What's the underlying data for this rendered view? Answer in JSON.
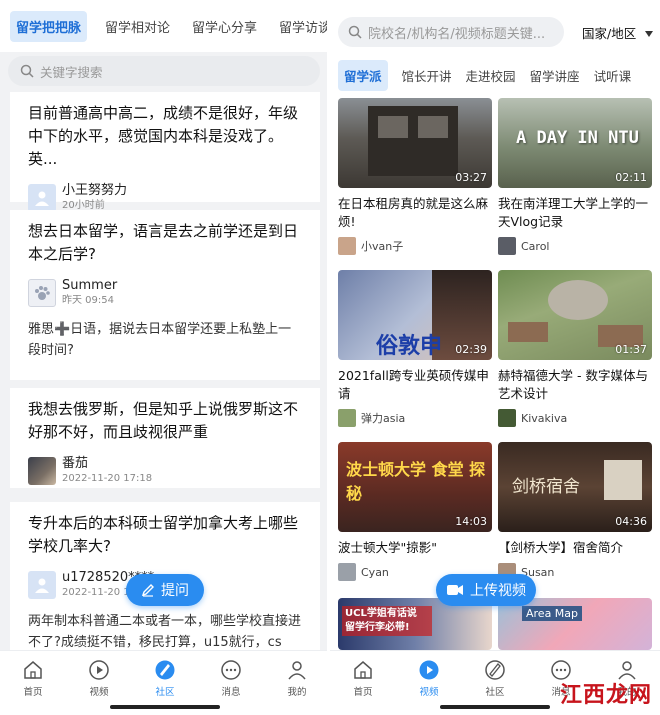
{
  "left": {
    "tabs": [
      "留学把把脉",
      "留学相对论",
      "留学心分享",
      "留学访谈"
    ],
    "search_placeholder": "关键字搜索",
    "posts": [
      {
        "title": "目前普通高中高二，成绩不是很好，年级中下的水平，感觉国内本科是没戏了。英...",
        "author": "小王努努力",
        "time": "20小时前",
        "body": ""
      },
      {
        "title": "想去日本留学，语言是去之前学还是到日本之后学?",
        "author": "Summer",
        "time": "昨天 09:54",
        "body": "雅思➕日语，据说去日本留学还要上私塾上一段时间?"
      },
      {
        "title": "我想去俄罗斯，但是知乎上说俄罗斯这不好那不好，而且歧视很严重",
        "author": "番茄",
        "time": "2022-11-20 17:18",
        "body": ""
      },
      {
        "title": "专升本后的本科硕士留学加拿大考上哪些学校几率大?",
        "author": "u1728520****",
        "time": "2022-11-20 16:4",
        "body": "两年制本科普通二本或者一本，哪些学校直接进不了?成绩挺不错，移民打算，u15就行，cs专..."
      }
    ],
    "fab_label": "提问",
    "nav": [
      "首页",
      "视频",
      "社区",
      "消息",
      "我的"
    ],
    "active_nav": "社区"
  },
  "right": {
    "search_placeholder": "院校名/机构名/视频标题关键...",
    "country_label": "国家/地区",
    "tabs": [
      "留学派",
      "馆长开讲",
      "走进校园",
      "留学讲座",
      "试听课"
    ],
    "videos": [
      {
        "title": "在日本租房真的就是这么麻烦!",
        "author": "小van子",
        "duration": "03:27",
        "overlay": ""
      },
      {
        "title": "我在南洋理工大学上学的一天Vlog记录",
        "author": "Carol",
        "duration": "02:11",
        "overlay": "A DAY IN NTU"
      },
      {
        "title": "2021fall跨专业英硕传媒申请",
        "author": "弹力asia",
        "duration": "02:39",
        "overlay": "俗敦申"
      },
      {
        "title": "赫特福德大学 - 数字媒体与艺术设计",
        "author": "Kivakiva",
        "duration": "01:37",
        "overlay": ""
      },
      {
        "title": "波士顿大学\"掠影\"",
        "author": "Cyan",
        "duration": "14:03",
        "overlay": "波士顿大学 食堂 探秘"
      },
      {
        "title": "【剑桥大学】宿舍简介",
        "author": "Susan",
        "duration": "04:36",
        "overlay": "剑桥宿舍"
      },
      {
        "title": "",
        "author": "",
        "duration": "",
        "overlay": "UCL学姐有话说 留学行李必带!"
      },
      {
        "title": "",
        "author": "",
        "duration": "",
        "overlay": "Area Map"
      }
    ],
    "fab_label": "上传视频",
    "nav": [
      "首页",
      "视频",
      "社区",
      "消息",
      "我的"
    ],
    "active_nav": "视频"
  },
  "colors": {
    "accent": "#2a8cf0",
    "active_tab_bg": "#dbeafb"
  },
  "watermark": "江西龙网"
}
